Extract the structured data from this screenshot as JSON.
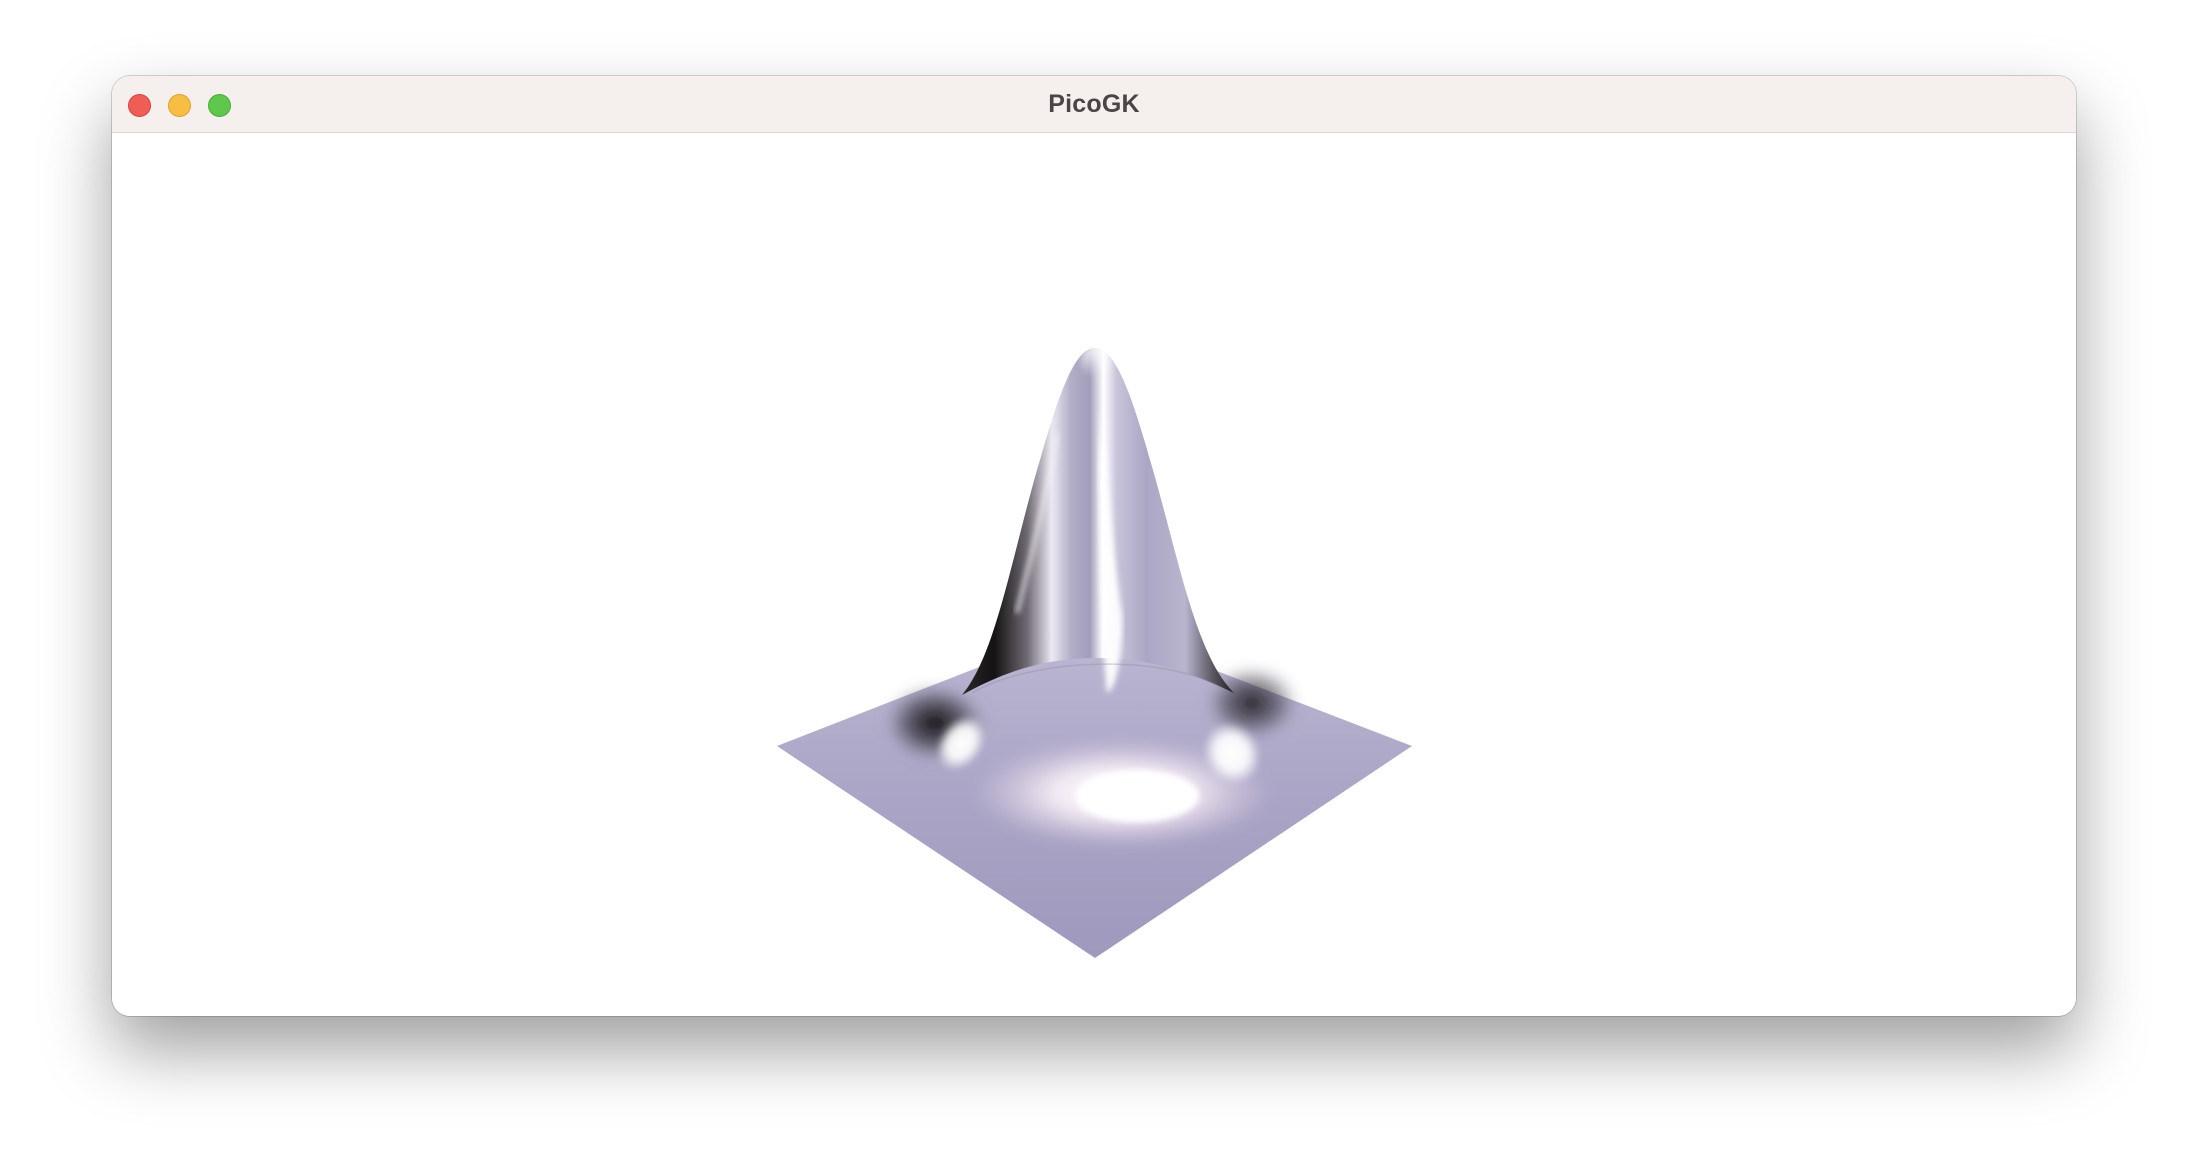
{
  "window": {
    "title": "PicoGK"
  },
  "titlebar": {
    "buttons": [
      {
        "name": "close",
        "color": "#ee5e57"
      },
      {
        "name": "minimize",
        "color": "#f6be43"
      },
      {
        "name": "maximize",
        "color": "#5fc84c"
      }
    ]
  },
  "viewport": {
    "background": "#ffffff",
    "object": "gaussian-bump-surface",
    "surface_color": "#aaa6c6"
  }
}
